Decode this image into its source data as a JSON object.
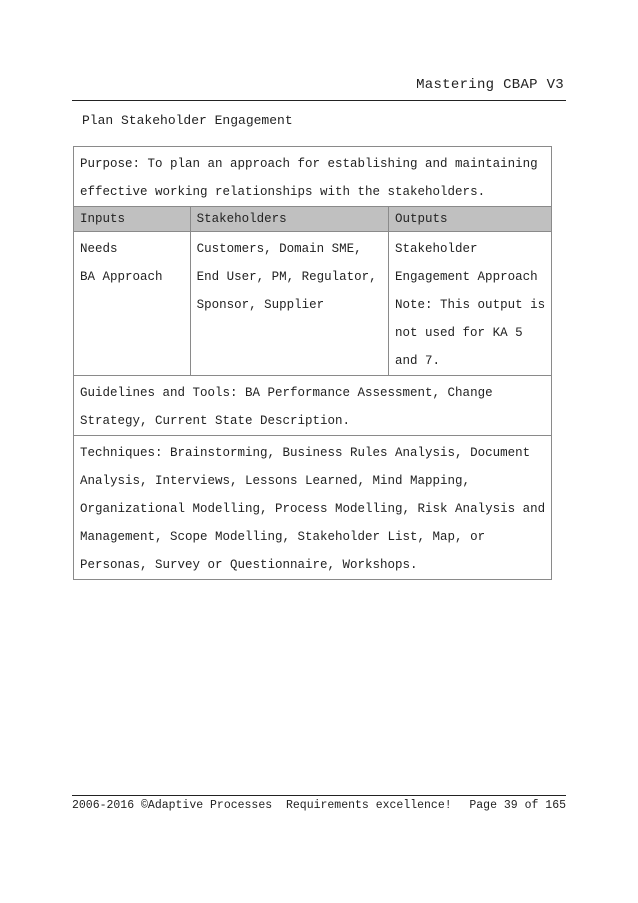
{
  "header": {
    "title": "Mastering CBAP V3"
  },
  "section": {
    "title": "Plan Stakeholder  Engagement"
  },
  "table": {
    "purpose_lines": [
      "Purpose: To plan an approach for establishing and  maintaining",
      "effective working relationships with the stakeholders."
    ],
    "columns": [
      "Inputs",
      "Stakeholders",
      "Outputs"
    ],
    "inputs": [
      "Needs",
      "BA Approach"
    ],
    "stakeholders": [
      "Customers, Domain SME,",
      "End User, PM, Regulator,",
      "Sponsor,  Supplier"
    ],
    "outputs": [
      "Stakeholder",
      "Engagement Approach",
      "Note: This output is",
      "not used for KA 5",
      "and 7."
    ],
    "guidelines_lines": [
      "Guidelines and Tools: BA Performance Assessment,  Change",
      "Strategy,  Current State Description."
    ],
    "techniques_lines": [
      "Techniques: Brainstorming,  Business Rules Analysis,  Document",
      "Analysis,  Interviews, Lessons Learned, Mind Mapping,",
      "Organizational Modelling, Process Modelling, Risk Analysis and",
      "Management, Scope Modelling, Stakeholder List, Map,  or",
      "Personas,  Survey or Questionnaire,  Workshops."
    ]
  },
  "footer": {
    "copyright": "2006-2016 ©Adaptive Processes",
    "tagline": "Requirements  excellence!",
    "page": "Page 39 of 165"
  }
}
